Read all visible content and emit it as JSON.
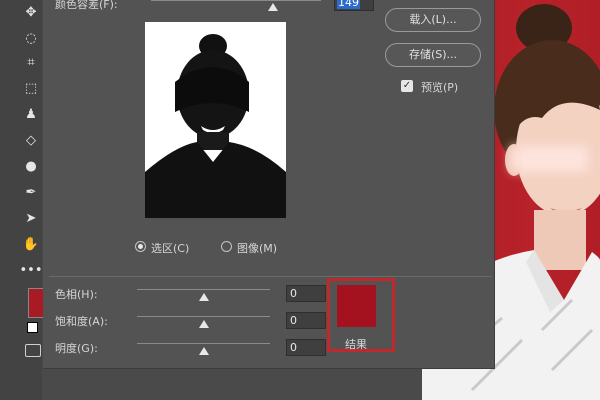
{
  "dialog": {
    "fuzziness_label": "颜色容差(F):",
    "fuzziness_value": "149",
    "load_button": "载入(L)...",
    "save_button": "存储(S)...",
    "preview_label": "预览(P)",
    "preview_checked": true,
    "radio_selection": "选区(C)",
    "radio_image": "图像(M)",
    "selected_radio": "selection",
    "result": {
      "hue_label": "色相(H):",
      "hue_value": "0",
      "saturation_label": "饱和度(A):",
      "saturation_value": "0",
      "lightness_label": "明度(G):",
      "lightness_value": "0",
      "result_label": "结果",
      "result_color": "#a3121e"
    }
  },
  "toolbar": {
    "tools": [
      "move-icon",
      "lasso-icon",
      "crop-icon",
      "frame-icon",
      "stamp-icon",
      "eraser-icon",
      "drop-icon",
      "pen-icon",
      "arrow-icon",
      "hand-icon",
      "more-icon"
    ],
    "foreground_color": "#a81a24"
  },
  "photo": {
    "background_color": "#b01e26"
  }
}
